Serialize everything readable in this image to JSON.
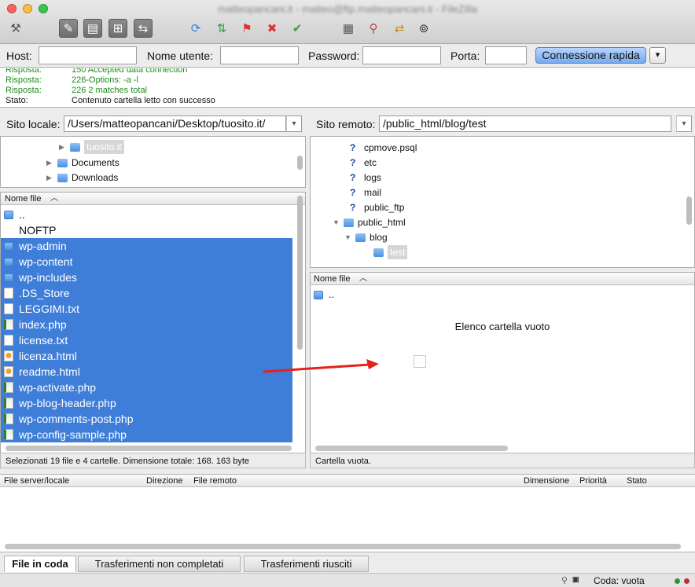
{
  "window": {
    "title": "matteopancani.it - matteo@ftp.matteopancani.it - FileZilla"
  },
  "toolbar": {
    "icons": [
      "site-manager-icon",
      "toggle-log-icon",
      "toggle-local-tree-icon",
      "toggle-remote-tree-icon",
      "transfer-queue-icon",
      "refresh-icon",
      "process-queue-icon",
      "cancel-icon",
      "disconnect-icon",
      "reconnect-icon",
      "directory-listing-filters-icon",
      "toggle-comparison-icon",
      "sync-browsing-icon",
      "search-remote-icon"
    ]
  },
  "quickconnect": {
    "host_label": "Host:",
    "host_value": "",
    "user_label": "Nome utente:",
    "user_value": "",
    "password_label": "Password:",
    "password_value": "",
    "port_label": "Porta:",
    "port_value": "",
    "connect_label": "Connessione rapida",
    "dropdown_glyph": "▾"
  },
  "log": [
    {
      "label": "Risposta:",
      "text": "150 Accepted data connection",
      "kind": "resp"
    },
    {
      "label": "Risposta:",
      "text": "226-Options: -a -l",
      "kind": "resp"
    },
    {
      "label": "Risposta:",
      "text": "226 2 matches total",
      "kind": "resp"
    },
    {
      "label": "Stato:",
      "text": "Contenuto cartella letto con successo",
      "kind": "stat"
    }
  ],
  "local": {
    "site_label": "Sito locale:",
    "path": "/Users/matteopancani/Desktop/tuosito.it/",
    "tree": [
      {
        "label": "tuosito.it",
        "depth": 2,
        "expanded": true,
        "selected": true
      },
      {
        "label": "Documents",
        "depth": 1,
        "expanded": false,
        "selected": false
      },
      {
        "label": "Downloads",
        "depth": 1,
        "expanded": false,
        "selected": false
      }
    ],
    "column_filename": "Nome file",
    "files": [
      {
        "name": "..",
        "icon": "folder",
        "selected": false
      },
      {
        "name": "NOFTP",
        "icon": "none",
        "selected": false
      },
      {
        "name": "wp-admin",
        "icon": "folder",
        "selected": true
      },
      {
        "name": "wp-content",
        "icon": "folder",
        "selected": true
      },
      {
        "name": "wp-includes",
        "icon": "folder",
        "selected": true
      },
      {
        "name": ".DS_Store",
        "icon": "file",
        "selected": true
      },
      {
        "name": "LEGGIMI.txt",
        "icon": "file",
        "selected": true
      },
      {
        "name": "index.php",
        "icon": "php",
        "selected": true
      },
      {
        "name": "license.txt",
        "icon": "file",
        "selected": true
      },
      {
        "name": "licenza.html",
        "icon": "html",
        "selected": true
      },
      {
        "name": "readme.html",
        "icon": "html",
        "selected": true
      },
      {
        "name": "wp-activate.php",
        "icon": "php",
        "selected": true
      },
      {
        "name": "wp-blog-header.php",
        "icon": "php",
        "selected": true
      },
      {
        "name": "wp-comments-post.php",
        "icon": "php",
        "selected": true
      },
      {
        "name": "wp-config-sample.php",
        "icon": "php",
        "selected": true
      }
    ],
    "status": "Selezionati 19 file e 4 cartelle. Dimensione totale: 168. 163 byte"
  },
  "remote": {
    "site_label": "Sito remoto:",
    "path": "/public_html/blog/test",
    "tree": [
      {
        "label": "cpmove.psql",
        "depth": 2,
        "kind": "q"
      },
      {
        "label": "etc",
        "depth": 2,
        "kind": "q"
      },
      {
        "label": "logs",
        "depth": 2,
        "kind": "q"
      },
      {
        "label": "mail",
        "depth": 2,
        "kind": "q"
      },
      {
        "label": "public_ftp",
        "depth": 2,
        "kind": "q"
      },
      {
        "label": "public_html",
        "depth": 1,
        "kind": "folder-open"
      },
      {
        "label": "blog",
        "depth": 2,
        "kind": "folder-open"
      },
      {
        "label": "test",
        "depth": 3,
        "kind": "folder-sel"
      }
    ],
    "column_filename": "Nome file",
    "files": [
      {
        "name": "..",
        "icon": "folder"
      }
    ],
    "empty_message": "Elenco cartella vuoto",
    "status": "Cartella vuota."
  },
  "queue": {
    "columns": [
      "File server/locale",
      "Direzione",
      "File remoto",
      "Dimensione",
      "Priorità",
      "Stato"
    ],
    "tabs": [
      "File in coda",
      "Trasferimenti non completati",
      "Trasferimenti riusciti"
    ],
    "active_tab": 0,
    "footer_status": "Coda: vuota"
  },
  "colors": {
    "selection": "#3f7ed8",
    "log_response": "#1e8c1e",
    "arrow": "#e2231a"
  }
}
